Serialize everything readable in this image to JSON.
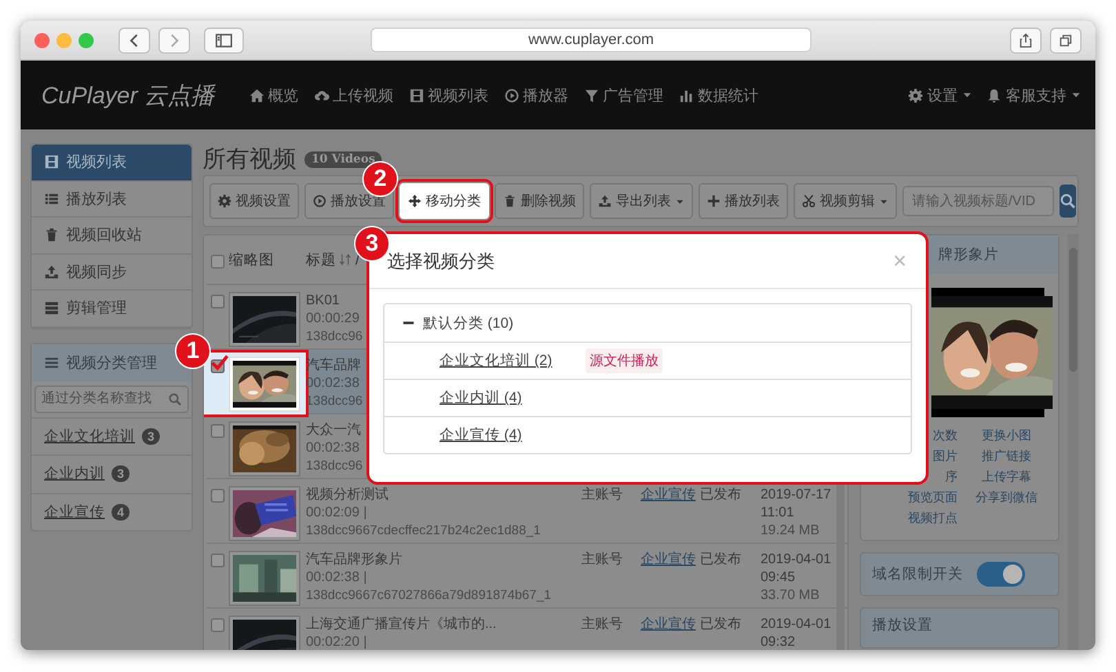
{
  "browser": {
    "url": "www.cuplayer.com"
  },
  "nav": {
    "logo": "CuPlayer 云点播",
    "items": [
      {
        "label": "概览"
      },
      {
        "label": "上传视频"
      },
      {
        "label": "视频列表"
      },
      {
        "label": "播放器"
      },
      {
        "label": "广告管理"
      },
      {
        "label": "数据统计"
      }
    ],
    "right": [
      {
        "label": "设置"
      },
      {
        "label": "客服支持"
      }
    ]
  },
  "sidebar": {
    "items": [
      {
        "label": "视频列表",
        "selected": true
      },
      {
        "label": "播放列表",
        "selected": false
      },
      {
        "label": "视频回收站",
        "selected": false
      },
      {
        "label": "视频同步",
        "selected": false
      },
      {
        "label": "剪辑管理",
        "selected": false
      }
    ],
    "category_panel": {
      "title": "视频分类管理",
      "search": {
        "placeholder": "通过分类名称查找"
      },
      "items": [
        {
          "label": "企业文化培训",
          "count": "3"
        },
        {
          "label": "企业内训",
          "count": "3"
        },
        {
          "label": "企业宣传",
          "count": "4"
        }
      ]
    }
  },
  "page": {
    "title": "所有视频",
    "count_badge": "10 Videos"
  },
  "toolbar": {
    "buttons": [
      {
        "label": "视频设置",
        "dropdown": false,
        "highlighted": false
      },
      {
        "label": "播放设置",
        "dropdown": false,
        "highlighted": false
      },
      {
        "label": "移动分类",
        "dropdown": false,
        "highlighted": true
      },
      {
        "label": "删除视频",
        "dropdown": false,
        "highlighted": false
      },
      {
        "label": "导出列表",
        "dropdown": true,
        "highlighted": false
      },
      {
        "label": "播放列表",
        "dropdown": false,
        "highlighted": false
      },
      {
        "label": "视频剪辑",
        "dropdown": true,
        "highlighted": false
      }
    ],
    "search": {
      "placeholder": "请输入视频标题/VID"
    }
  },
  "table": {
    "select_all": {
      "checked": false
    },
    "columns": [
      {
        "label": "缩略图"
      },
      {
        "label": "标题"
      }
    ],
    "title_separator": "/",
    "rows": [
      {
        "title": "BK01",
        "duration": "00:00:29",
        "hash": "138dcc96",
        "checked": false,
        "selected": false
      },
      {
        "title": "汽车品牌",
        "duration": "00:02:38",
        "hash": "138dcc96",
        "checked": true,
        "selected": true
      },
      {
        "title": "大众一汽",
        "duration": "00:02:38",
        "hash": "138dcc96",
        "checked": false,
        "selected": false
      },
      {
        "title": "视频分析测试",
        "duration": "00:02:09 |",
        "hash": "138dcc9667cdecffec217b24c2ec1d88_1",
        "account": "主账号",
        "category": "企业宣传",
        "status": "已发布",
        "date": "2019-07-17",
        "time": "11:01",
        "size": "19.24 MB",
        "checked": false,
        "selected": false
      },
      {
        "title": "汽车品牌形象片",
        "duration": "00:02:38 |",
        "hash": "138dcc9667c67027866a79d891874b67_1",
        "account": "主账号",
        "category": "企业宣传",
        "status": "已发布",
        "date": "2019-04-01",
        "time": "09:45",
        "size": "33.70 MB",
        "checked": false,
        "selected": false
      },
      {
        "title": "上海交通广播宣传片《城市的...",
        "duration": "00:02:20 |",
        "account": "主账号",
        "category": "企业宣传",
        "status": "已发布",
        "date": "2019-04-01",
        "time": "09:32",
        "checked": false,
        "selected": false
      }
    ]
  },
  "right_panel": {
    "title": "牌形象片",
    "links": [
      "次数",
      "更换小图",
      "图片",
      "推广链接",
      "序",
      "上传字幕",
      "预览页面",
      "分享到微信",
      "视频打点"
    ],
    "domain_switch": {
      "label": "域名限制开关",
      "on": true
    },
    "next_panel_title": "播放设置"
  },
  "modal": {
    "title": "选择视频分类",
    "close": "×",
    "tree": [
      {
        "label": "默认分类 (10)",
        "expanded": true,
        "children": [
          {
            "label": "企业文化培训 (2)",
            "tag": "源文件播放"
          },
          {
            "label": "企业内训 (4)"
          },
          {
            "label": "企业宣传 (4)"
          }
        ]
      }
    ]
  },
  "annotations": [
    {
      "label": "1"
    },
    {
      "label": "2"
    },
    {
      "label": "3"
    }
  ]
}
